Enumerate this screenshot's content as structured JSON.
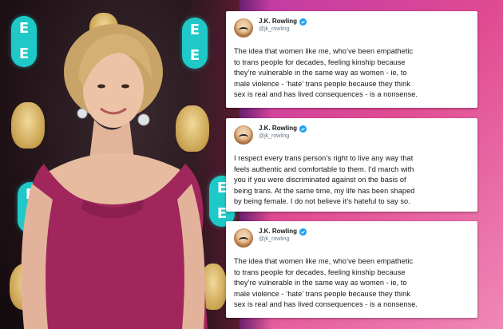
{
  "tweets": [
    {
      "author": "J.K. Rowling",
      "handle": "@jk_rowling",
      "text": "The idea that women like me, who’ve been empathetic\nto trans people for decades, feeling kinship because\nthey’re vulnerable in the same way as women - ie, to\nmale violence - ‘hate’ trans people because they think\nsex is real and has lived consequences - is a nonsense."
    },
    {
      "author": "J.K. Rowling",
      "handle": "@jk_rowling",
      "text": "I respect every trans person’s right to live any way that\nfeels authentic and comfortable to them. I’d march with\nyou if you were discriminated against on the basis of\nbeing trans. At the same time, my life has been shaped\nby being female. I do not believe it’s hateful to say so."
    },
    {
      "author": "J.K. Rowling",
      "handle": "@jk_rowling",
      "text": "The idea that women like me, who’ve been empathetic\nto trans people for decades, feeling kinship because\nthey’re vulnerable in the same way as women - ie, to\nmale violence - ‘hate’ trans people because they think\nsex is real and has lived consequences - is a nonsense."
    }
  ],
  "background": {
    "ee_letter": "EE"
  },
  "colors": {
    "panel_start": "#c03aa6",
    "panel_end": "#f088b6",
    "verified": "#1da1f2",
    "dress": "#a0265c"
  }
}
